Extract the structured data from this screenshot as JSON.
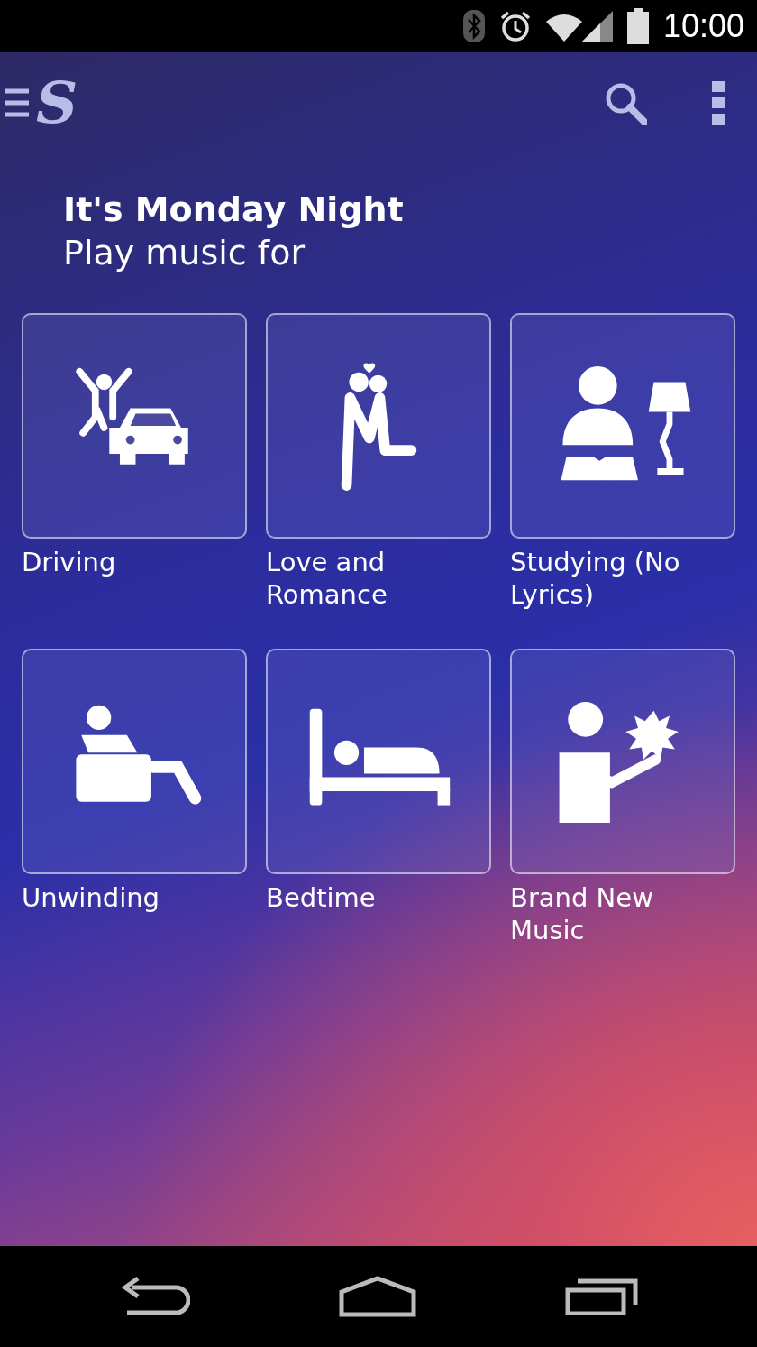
{
  "status_bar": {
    "time": "10:00"
  },
  "app_bar": {
    "logo": "S"
  },
  "greeting": {
    "title": "It's Monday Night",
    "subtitle": "Play music for"
  },
  "tiles": [
    {
      "label": "Driving",
      "kind": "driving"
    },
    {
      "label": "Love and Romance",
      "kind": "love"
    },
    {
      "label": "Studying (No Lyrics)",
      "kind": "studying"
    },
    {
      "label": "Unwinding",
      "kind": "unwinding"
    },
    {
      "label": "Bedtime",
      "kind": "bedtime"
    },
    {
      "label": "Brand New Music",
      "kind": "new"
    }
  ]
}
